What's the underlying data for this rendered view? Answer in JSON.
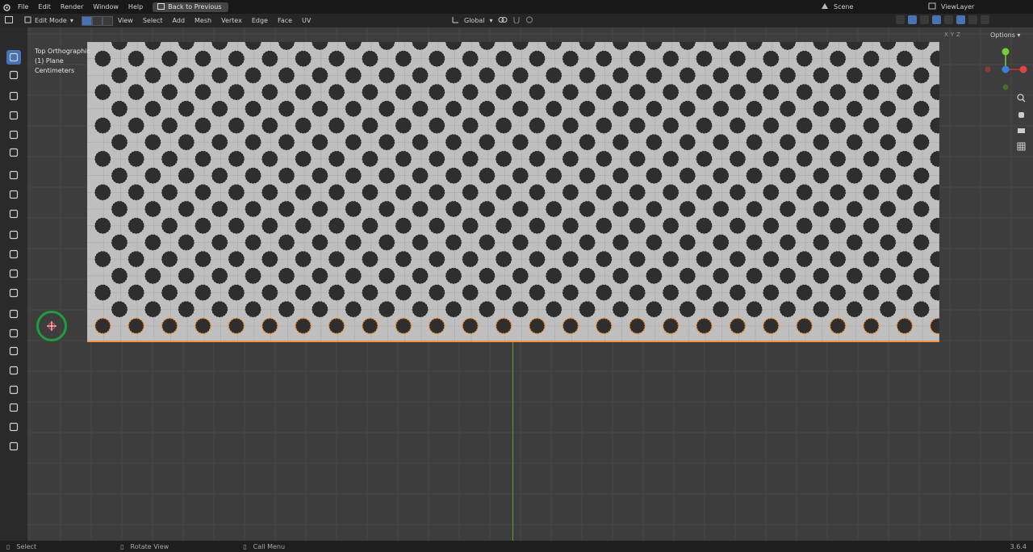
{
  "menubar": {
    "items": [
      "File",
      "Edit",
      "Render",
      "Window",
      "Help"
    ],
    "back_label": "Back to Previous",
    "scene": "Scene",
    "view_layer": "ViewLayer"
  },
  "header": {
    "mode": "Edit Mode",
    "menus": [
      "View",
      "Select",
      "Add",
      "Mesh",
      "Vertex",
      "Edge",
      "Face",
      "UV"
    ],
    "orientation": "Global",
    "options_label": "Options",
    "axis_toggles": [
      "X",
      "Y",
      "Z"
    ]
  },
  "viewport": {
    "view_name": "Top Orthographic",
    "object_label": "(1) Plane",
    "units": "Centimeters",
    "colors": {
      "background": "#3d3d3d",
      "mesh": "#bfbfbf",
      "holes": "#2e2e2e",
      "selected": "#ff8c1a",
      "y_axis": "#6a9a2a"
    }
  },
  "toolbar": {
    "tools": [
      "select-box-icon",
      "cursor-icon",
      "move-icon",
      "rotate-icon",
      "scale-icon",
      "transform-icon",
      "annotate-icon",
      "measure-icon",
      "add-cube-icon",
      "extrude-icon",
      "inset-icon",
      "bevel-icon",
      "loop-cut-icon",
      "knife-icon",
      "poly-build-icon",
      "spin-icon",
      "smooth-icon",
      "edge-slide-icon",
      "shrink-fatten-icon",
      "shear-icon",
      "rip-icon"
    ]
  },
  "statusbar": {
    "select": "Select",
    "rotate": "Rotate View",
    "call_menu": "Call Menu",
    "version": "3.6.4"
  }
}
